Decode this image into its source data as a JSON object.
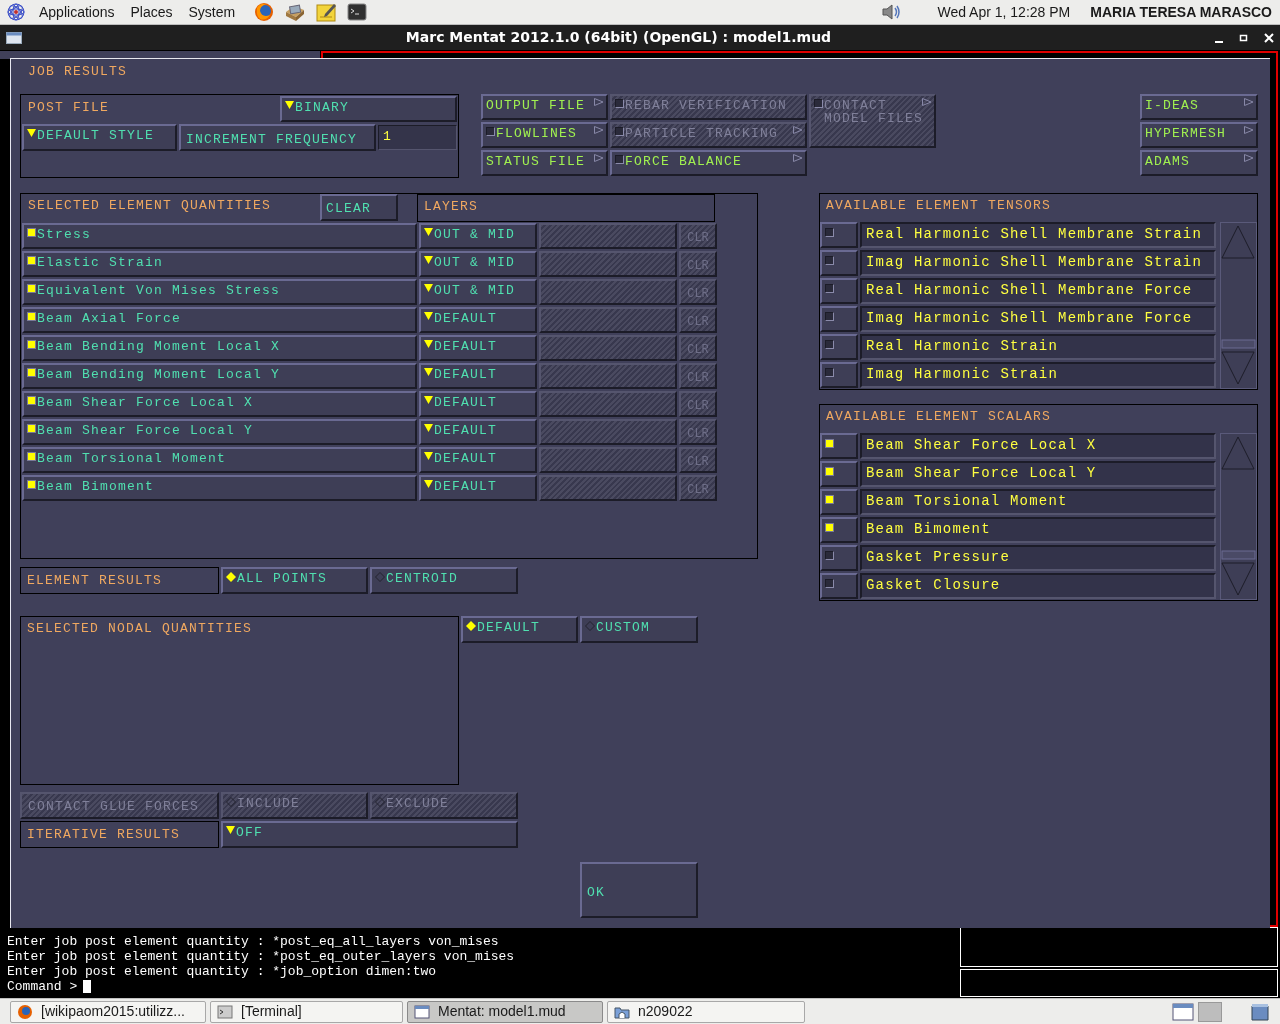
{
  "top_panel": {
    "menus": [
      "Applications",
      "Places",
      "System"
    ],
    "clock": "Wed Apr  1, 12:28 PM",
    "user": "MARIA TERESA MARASCO"
  },
  "window": {
    "title": "Marc Mentat 2012.1.0 (64bit) (OpenGL) : model1.mud"
  },
  "dialog": {
    "title": "JOB RESULTS",
    "post_file": {
      "label": "POST FILE",
      "format": "BINARY",
      "style": "DEFAULT STYLE",
      "increment_label": "INCREMENT FREQUENCY",
      "increment_value": "1"
    },
    "output_buttons": [
      {
        "label": "OUTPUT FILE",
        "kind": "menu",
        "disabled": false
      },
      {
        "label": "FLOWLINES",
        "kind": "toggle_menu",
        "checked": false,
        "disabled": false
      },
      {
        "label": "STATUS FILE",
        "kind": "menu",
        "disabled": false
      }
    ],
    "tracking_buttons": [
      {
        "label": "REBAR VERIFICATION",
        "kind": "toggle",
        "checked": false,
        "disabled": true
      },
      {
        "label": "PARTICLE TRACKING",
        "kind": "toggle_menu",
        "checked": false,
        "disabled": true
      },
      {
        "label": "FORCE BALANCE",
        "kind": "toggle_menu",
        "checked": false,
        "disabled": false
      }
    ],
    "contact_button": {
      "label": "CONTACT\nMODEL FILES",
      "kind": "toggle_menu",
      "checked": false,
      "disabled": true
    },
    "export_buttons": [
      {
        "label": "I-DEAS",
        "kind": "menu"
      },
      {
        "label": "HYPERMESH",
        "kind": "menu"
      },
      {
        "label": "ADAMS",
        "kind": "menu"
      }
    ],
    "element_quantities": {
      "title": "SELECTED ELEMENT QUANTITIES",
      "clear": "CLEAR",
      "layers_title": "LAYERS",
      "rows": [
        {
          "name": "Stress",
          "checked": true,
          "layer": "OUT & MID",
          "clr": "CLR",
          "clr_disabled": true
        },
        {
          "name": "Elastic Strain",
          "checked": true,
          "layer": "OUT & MID",
          "clr": "CLR",
          "clr_disabled": true
        },
        {
          "name": "Equivalent Von Mises Stress",
          "checked": true,
          "layer": "OUT & MID",
          "clr": "CLR",
          "clr_disabled": true
        },
        {
          "name": "Beam Axial Force",
          "checked": true,
          "layer": "DEFAULT",
          "clr": "CLR",
          "clr_disabled": true
        },
        {
          "name": "Beam Bending Moment Local X",
          "checked": true,
          "layer": "DEFAULT",
          "clr": "CLR",
          "clr_disabled": true
        },
        {
          "name": "Beam Bending Moment Local Y",
          "checked": true,
          "layer": "DEFAULT",
          "clr": "CLR",
          "clr_disabled": true
        },
        {
          "name": "Beam Shear Force Local X",
          "checked": true,
          "layer": "DEFAULT",
          "clr": "CLR",
          "clr_disabled": true
        },
        {
          "name": "Beam Shear Force Local Y",
          "checked": true,
          "layer": "DEFAULT",
          "clr": "CLR",
          "clr_disabled": true
        },
        {
          "name": "Beam Torsional Moment",
          "checked": true,
          "layer": "DEFAULT",
          "clr": "CLR",
          "clr_disabled": true
        },
        {
          "name": "Beam Bimoment",
          "checked": true,
          "layer": "DEFAULT",
          "clr": "CLR",
          "clr_disabled": true
        }
      ]
    },
    "element_results": {
      "label": "ELEMENT RESULTS",
      "options": [
        {
          "label": "ALL POINTS",
          "selected": true
        },
        {
          "label": "CENTROID",
          "selected": false
        }
      ]
    },
    "nodal_quantities": {
      "title": "SELECTED NODAL QUANTITIES",
      "options": [
        {
          "label": "DEFAULT",
          "selected": true
        },
        {
          "label": "CUSTOM",
          "selected": false
        }
      ]
    },
    "contact_glue_forces": {
      "label": "CONTACT GLUE FORCES",
      "disabled": true,
      "options": [
        {
          "label": "INCLUDE",
          "selected": false
        },
        {
          "label": "EXCLUDE",
          "selected": false
        }
      ]
    },
    "iterative_results": {
      "label": "ITERATIVE RESULTS",
      "value": "OFF"
    },
    "ok": "OK",
    "tensors": {
      "title": "AVAILABLE ELEMENT TENSORS",
      "items": [
        {
          "label": "Real Harmonic Shell Membrane Strain",
          "checked": false
        },
        {
          "label": "Imag Harmonic Shell Membrane Strain",
          "checked": false
        },
        {
          "label": "Real Harmonic Shell Membrane Force",
          "checked": false
        },
        {
          "label": "Imag Harmonic Shell Membrane Force",
          "checked": false
        },
        {
          "label": "Real Harmonic Strain",
          "checked": false
        },
        {
          "label": "Imag Harmonic Strain",
          "checked": false
        }
      ]
    },
    "scalars": {
      "title": "AVAILABLE ELEMENT SCALARS",
      "items": [
        {
          "label": "Beam Shear Force Local X",
          "checked": true
        },
        {
          "label": "Beam Shear Force Local Y",
          "checked": true
        },
        {
          "label": "Beam Torsional Moment",
          "checked": true
        },
        {
          "label": "Beam Bimoment",
          "checked": true
        },
        {
          "label": "Gasket Pressure",
          "checked": false
        },
        {
          "label": "Gasket Closure",
          "checked": false
        }
      ]
    }
  },
  "console": {
    "lines": [
      "Enter job post element quantity : *post_eq_all_layers von_mises",
      "Enter job post element quantity : *post_eq_outer_layers von_mises",
      "Enter job post element quantity : *job_option dimen:two"
    ],
    "prompt": "Command >"
  },
  "taskbar": [
    {
      "label": "[wikipaom2015:utilizz...",
      "selected": false,
      "kind": "browser"
    },
    {
      "label": "[Terminal]",
      "selected": false,
      "kind": "terminal"
    },
    {
      "label": "Mentat: model1.mud",
      "selected": true,
      "kind": "window"
    },
    {
      "label": "n209022",
      "selected": false,
      "kind": "folder"
    }
  ]
}
